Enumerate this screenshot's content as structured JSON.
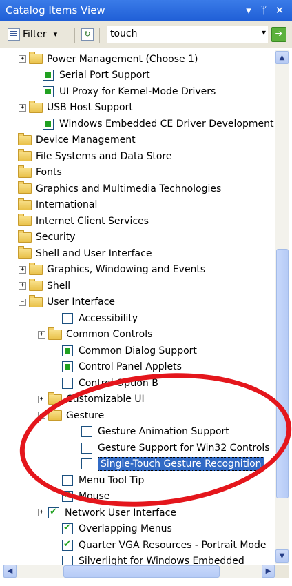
{
  "window": {
    "title": "Catalog Items View",
    "menu_glyph": "▾",
    "pin_glyph": "ᛘ",
    "close_glyph": "✕"
  },
  "toolbar": {
    "filter_label": "Filter",
    "filter_caret": "▾",
    "search_value": "touch",
    "search_caret": "▾",
    "go_glyph": "➔"
  },
  "tree": [
    {
      "label": "Power Management (Choose 1)",
      "type": "folder",
      "expander": "+"
    },
    {
      "label": "Serial Port Support",
      "type": "filled"
    },
    {
      "label": "UI Proxy for Kernel-Mode Drivers",
      "type": "filled"
    },
    {
      "label": "USB Host Support",
      "type": "folder",
      "expander": "+"
    },
    {
      "label": "Windows Embedded CE Driver Development Kit",
      "type": "filled"
    },
    {
      "label": "Device Management",
      "type": "folder"
    },
    {
      "label": "File Systems and Data Store",
      "type": "folder"
    },
    {
      "label": "Fonts",
      "type": "folder"
    },
    {
      "label": "Graphics and Multimedia Technologies",
      "type": "folder"
    },
    {
      "label": "International",
      "type": "folder"
    },
    {
      "label": "Internet Client Services",
      "type": "folder"
    },
    {
      "label": "Security",
      "type": "folder"
    },
    {
      "label": "Shell and User Interface",
      "type": "folder"
    },
    {
      "label": "Graphics, Windowing and Events",
      "type": "folder",
      "expander": "+"
    },
    {
      "label": "Shell",
      "type": "folder",
      "expander": "+"
    },
    {
      "label": "User Interface",
      "type": "folder",
      "expander": "−"
    },
    {
      "label": "Accessibility",
      "type": "empty"
    },
    {
      "label": "Common Controls",
      "type": "folder",
      "expander": "+"
    },
    {
      "label": "Common Dialog Support",
      "type": "filled"
    },
    {
      "label": "Control Panel Applets",
      "type": "filled"
    },
    {
      "label": "Control Option B",
      "type": "empty"
    },
    {
      "label": "Customizable UI",
      "type": "folder",
      "expander": "+"
    },
    {
      "label": "Gesture",
      "type": "folder",
      "expander": "−"
    },
    {
      "label": "Gesture Animation Support",
      "type": "empty"
    },
    {
      "label": "Gesture Support for Win32 Controls",
      "type": "empty"
    },
    {
      "label": "Single-Touch Gesture Recognition",
      "type": "empty",
      "selected": true
    },
    {
      "label": "Menu Tool Tip",
      "type": "empty"
    },
    {
      "label": "Mouse",
      "type": "checked"
    },
    {
      "label": "Network User Interface",
      "type": "checked",
      "expander": "+"
    },
    {
      "label": "Overlapping Menus",
      "type": "checked"
    },
    {
      "label": "Quarter VGA Resources - Portrait Mode",
      "type": "checked"
    },
    {
      "label": "Silverlight for Windows Embedded",
      "type": "empty"
    }
  ],
  "scrollbars": {
    "up": "▲",
    "down": "▼",
    "left": "◀",
    "right": "▶"
  }
}
